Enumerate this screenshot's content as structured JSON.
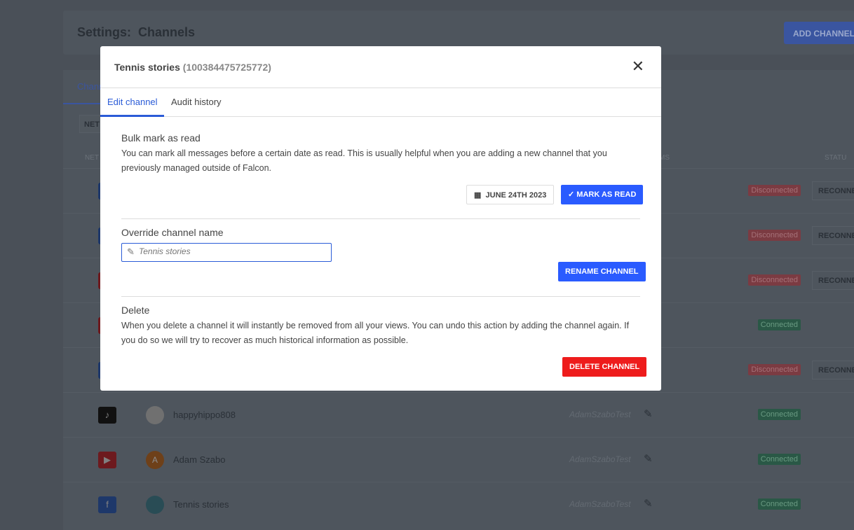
{
  "page": {
    "title": "Settings:  Channels",
    "add_button": "ADD CHANNEL",
    "tab": "Channels",
    "network_filter": "NET",
    "col_network": "NET",
    "col_teams": "MS",
    "col_status": "STATU",
    "reconnect": "RECONNECT"
  },
  "rows": [
    {
      "network": "facebook",
      "color": "#3b6fd4",
      "status": "Disconnected",
      "reconnect": true
    },
    {
      "network": "facebook",
      "color": "#3b6fd4",
      "status": "Disconnected",
      "reconnect": true
    },
    {
      "network": "youtube",
      "color": "#d9343b",
      "status": "Disconnected",
      "reconnect": true
    },
    {
      "network": "youtube",
      "color": "#d9343b",
      "status": "Connected",
      "reconnect": false
    },
    {
      "network": "facebook",
      "color": "#3b6fd4",
      "status": "Disconnected",
      "reconnect": true
    },
    {
      "network": "tiktok",
      "color": "#222",
      "avatar": "",
      "avatar_color": "#ccc",
      "name": "happyhippo808",
      "team": "AdamSzaboTest",
      "status": "Connected"
    },
    {
      "network": "youtube",
      "color": "#d9343b",
      "avatar": "A",
      "avatar_color": "#c8742e",
      "name": "Adam Szabo",
      "team": "AdamSzaboTest",
      "status": "Connected"
    },
    {
      "network": "facebook",
      "color": "#3b6fd4",
      "avatar": "",
      "avatar_color": "#4a8a9a",
      "name": "Tennis stories",
      "team": "AdamSzaboTest",
      "status": "Connected"
    }
  ],
  "modal": {
    "title": "Tennis stories",
    "id": "(100384475725772)",
    "tabs": [
      "Edit channel",
      "Audit history"
    ],
    "bulk": {
      "title": "Bulk mark as read",
      "desc": "You can mark all messages before a certain date as read. This is usually helpful when you are adding a new channel that you previously managed outside of Falcon.",
      "date": "JUNE 24TH 2023",
      "button": "MARK AS READ"
    },
    "rename": {
      "title": "Override channel name",
      "placeholder": "Tennis stories",
      "value": "",
      "button": "RENAME CHANNEL"
    },
    "delete": {
      "title": "Delete",
      "desc": "When you delete a channel it will instantly be removed from all your views. You can undo this action by adding the channel again. If you do so we will try to recover as much historical information as possible.",
      "button": "DELETE CHANNEL"
    }
  },
  "colors": {
    "accent": "#2a5bff",
    "danger": "#ee1c1c"
  }
}
